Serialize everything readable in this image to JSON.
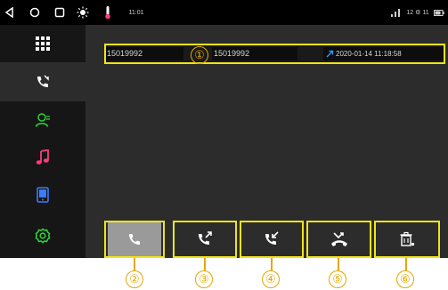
{
  "status_bar": {
    "time": "11:01",
    "right_status": "12 ⚙ 11",
    "icons": [
      "back-icon",
      "home-icon",
      "recent-apps-icon",
      "brightness-icon",
      "temperature-icon",
      "signal-icon",
      "battery-icon"
    ]
  },
  "sidebar": {
    "items": [
      {
        "name": "apps-grid-icon",
        "active": false
      },
      {
        "name": "call-log-icon",
        "active": true
      },
      {
        "name": "contacts-icon",
        "active": false
      },
      {
        "name": "music-icon",
        "active": false
      },
      {
        "name": "phone-device-icon",
        "active": false
      },
      {
        "name": "settings-icon",
        "active": false
      }
    ]
  },
  "call_log": {
    "rows": [
      {
        "number": "15019992",
        "name": "15019992",
        "call_type_icon": "outgoing-call-icon",
        "datetime": "2020-01-14 11:18:58"
      }
    ]
  },
  "toolbar": {
    "buttons": [
      {
        "name": "all-calls-button",
        "icon": "phone-icon",
        "selected": true
      },
      {
        "name": "outgoing-calls-button",
        "icon": "outgoing-call-icon",
        "selected": false
      },
      {
        "name": "incoming-calls-button",
        "icon": "incoming-call-icon",
        "selected": false
      },
      {
        "name": "missed-calls-button",
        "icon": "missed-call-icon",
        "selected": false
      },
      {
        "name": "delete-log-button",
        "icon": "trash-icon",
        "selected": false
      }
    ]
  },
  "annotations": {
    "markers": [
      "①",
      "②",
      "③",
      "④",
      "⑤",
      "⑥"
    ]
  },
  "colors": {
    "highlight": "#f0e418",
    "marker": "#e4a800",
    "icon": "#ffffff",
    "accent_green": "#2fd03f",
    "accent_pink": "#ff3b7c",
    "accent_blue": "#3a7bff"
  }
}
